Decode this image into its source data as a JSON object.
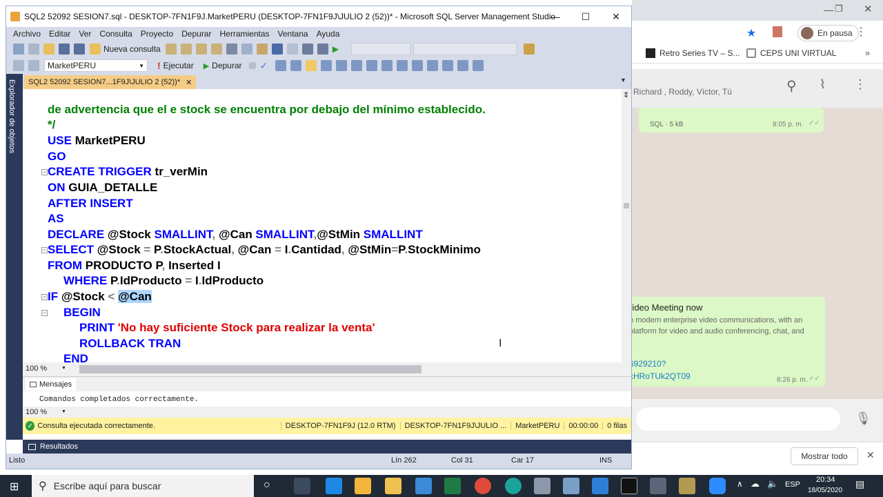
{
  "browser": {
    "status_pill": "En pausa",
    "bookmarks": [
      "Retro Series TV – S...",
      "CEPS UNI VIRTUAL"
    ],
    "chat_members": "Richard , Roddy, Víctor, Tú",
    "msg1_meta": "SQL · 5 kB",
    "msg1_time": "8:05 p. m.",
    "msg2_title": "Video Meeting now",
    "msg2_desc": "n modern enterprise video communications, with an platform for video and audio conferencing, chat, and",
    "msg2_link1": "6929210?",
    "msg2_link2": "cHRoTUk2QT09",
    "msg2_time": "8:26 p. m.",
    "show_all": "Mostrar todo"
  },
  "ssms": {
    "title": "SQL2 52092 SESION7.sql - DESKTOP-7FN1F9J.MarketPERU (DESKTOP-7FN1F9J\\JULIO 2 (52))* - Microsoft SQL Server Management Studio",
    "menu": [
      "Archivo",
      "Editar",
      "Ver",
      "Consulta",
      "Proyecto",
      "Depurar",
      "Herramientas",
      "Ventana",
      "Ayuda"
    ],
    "new_query": "Nueva consulta",
    "database": "MarketPERU",
    "execute": "Ejecutar",
    "debug": "Depurar",
    "side_panel": "Explorador de objetos",
    "doc_tab": "SQL2 52092 SESION7...1F9J\\JULIO 2 (52))*",
    "zoom": "100 %",
    "messages_tab": "Mensajes",
    "message_text": "Comandos completados correctamente.",
    "query_status": "Consulta ejecutada correctamente.",
    "server": "DESKTOP-7FN1F9J (12.0 RTM)",
    "login": "DESKTOP-7FN1F9J\\JULIO ...",
    "db_status": "MarketPERU",
    "elapsed": "00:00:00",
    "rows": "0 filas",
    "results_tab": "Resultados",
    "status_ready": "Listo",
    "line": "Lín 262",
    "col": "Col 31",
    "char": "Car 17",
    "mode": "INS"
  },
  "code": {
    "l0": "de advertencia que el e stock se encuentra por debajo del mínimo establecido.",
    "l1": "*/",
    "l2a": "USE",
    "l2b": " MarketPERU",
    "l3": "GO",
    "l4a": "CREATE TRIGGER",
    "l4b": " tr_verMin",
    "l5a": "ON",
    "l5b": " GUIA_DETALLE",
    "l6": "AFTER INSERT",
    "l7": "AS",
    "l8a": "DECLARE",
    "l8b": " @Stock ",
    "l8c": "SMALLINT",
    "l8d": ",",
    "l8e": " @Can ",
    "l8f": "SMALLINT",
    "l8g": ",",
    "l8h": "@StMin ",
    "l8i": "SMALLINT",
    "l9a": "SELECT",
    "l9b": " @Stock ",
    "l9c": "=",
    "l9d": " P",
    "l9e": ".",
    "l9f": "StockActual",
    "l9g": ",",
    "l9h": " @Can ",
    "l9i": "=",
    "l9j": " I",
    "l9k": ".",
    "l9l": "Cantidad",
    "l9m": ",",
    "l9n": " @StMin",
    "l9o": "=",
    "l9p": "P",
    "l9q": ".",
    "l9r": "StockMinimo",
    "l10a": "FROM",
    "l10b": " PRODUCTO P",
    "l10c": ",",
    "l10d": " Inserted I",
    "l11a": "WHERE",
    "l11b": " P",
    "l11c": ".",
    "l11d": "IdProducto ",
    "l11e": "=",
    "l11f": " I",
    "l11g": ".",
    "l11h": "IdProducto",
    "l12a": "IF",
    "l12b": " @Stock ",
    "l12c": "<",
    "l12d": "@Can",
    "l13": "BEGIN",
    "l14a": "PRINT",
    "l14b": "'No hay suficiente Stock para realizar la venta'",
    "l15": "ROLLBACK TRAN",
    "l16": "END"
  },
  "taskbar": {
    "search": "Escribe aquí para buscar",
    "lang": "ESP",
    "time": "20:34",
    "date": "18/05/2020"
  }
}
